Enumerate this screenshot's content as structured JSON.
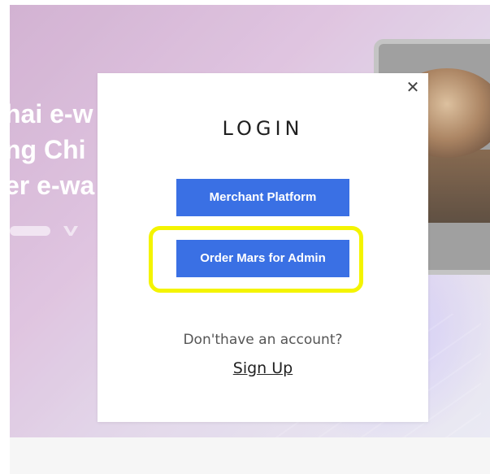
{
  "background": {
    "headline_lines": [
      "hai e-w",
      "ng Chi",
      "er e-wa"
    ],
    "colors": {
      "hero_start": "#c9a2c9",
      "hero_end": "#e6e6f2",
      "footer": "#f4f4f4"
    }
  },
  "login_modal": {
    "close_glyph": "✕",
    "title": "LOGIN",
    "buttons": [
      {
        "label": "Merchant Platform"
      },
      {
        "label": "Order Mars for Admin"
      }
    ],
    "no_account_text": "Don'thave an account?",
    "signup_label": "Sign Up",
    "colors": {
      "button_bg": "#3a70e4",
      "button_text": "#ffffff",
      "highlight": "#f4f400"
    }
  }
}
